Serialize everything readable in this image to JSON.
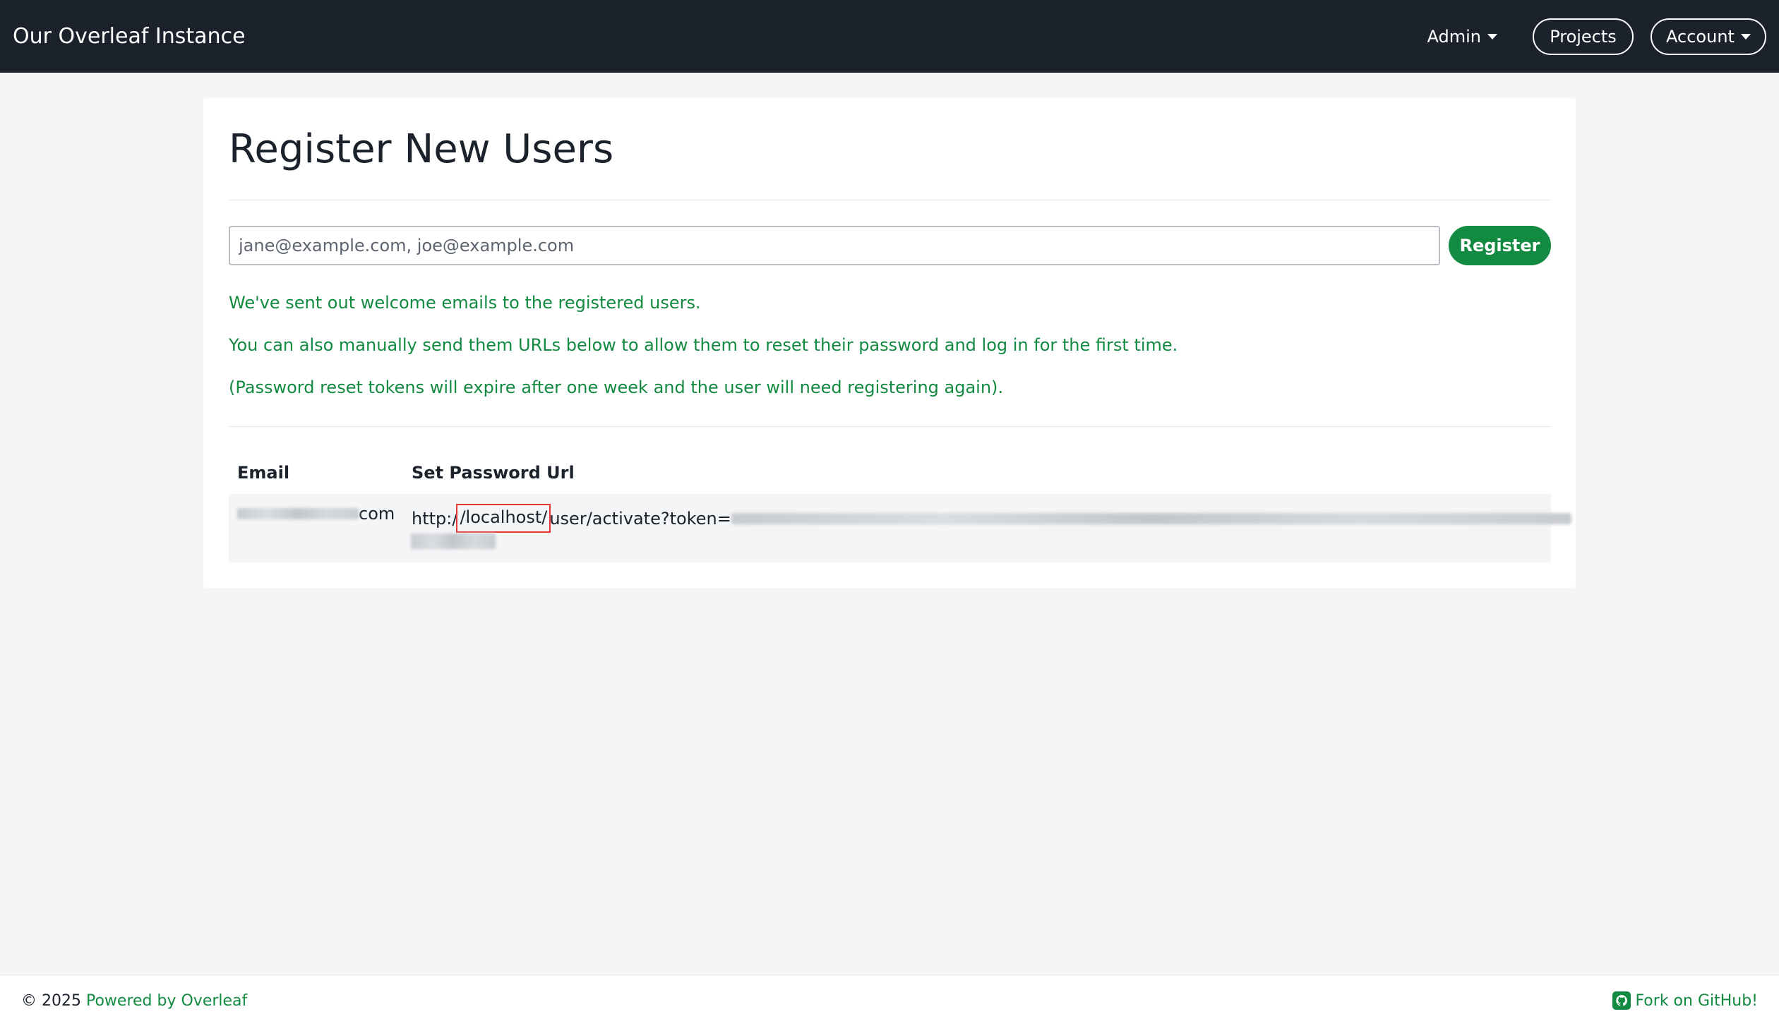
{
  "navbar": {
    "brand": "Our Overleaf Instance",
    "admin_label": "Admin",
    "projects_label": "Projects",
    "account_label": "Account"
  },
  "main": {
    "title": "Register New Users",
    "email_placeholder": "jane@example.com, joe@example.com",
    "register_label": "Register",
    "messages": [
      "We've sent out welcome emails to the registered users.",
      "You can also manually send them URLs below to allow them to reset their password and log in for the first time.",
      "(Password reset tokens will expire after one week and the user will need registering again)."
    ],
    "table": {
      "headers": [
        "Email",
        "Set Password Url"
      ],
      "rows": [
        {
          "email_suffix": "com",
          "url_prefix": "http:/",
          "url_host": "/localhost/",
          "url_path": "user/activate?token="
        }
      ]
    }
  },
  "footer": {
    "copyright": "© 2025",
    "powered_label": "Powered by Overleaf",
    "github_label": "Fork on GitHub!"
  },
  "colors": {
    "navbar": "#1b222c",
    "accent": "#138a41",
    "highlight": "#e53935"
  }
}
